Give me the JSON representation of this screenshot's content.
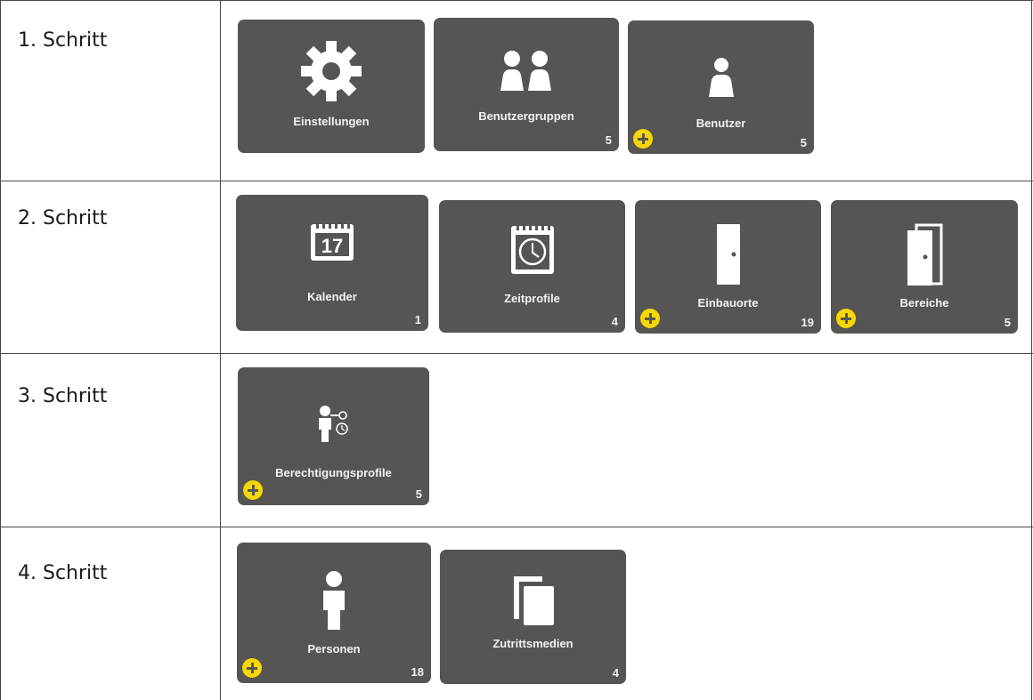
{
  "steps": [
    {
      "label": "1. Schritt"
    },
    {
      "label": "2. Schritt"
    },
    {
      "label": "3. Schritt"
    },
    {
      "label": "4. Schritt"
    }
  ],
  "tiles": {
    "einstellungen": {
      "label": "Einstellungen",
      "icon": "gear-icon"
    },
    "benutzergruppen": {
      "label": "Benutzergruppen",
      "count": "5",
      "icon": "user-group-icon"
    },
    "benutzer": {
      "label": "Benutzer",
      "count": "5",
      "icon": "user-icon",
      "add": "add-icon"
    },
    "kalender": {
      "label": "Kalender",
      "count": "1",
      "icon": "calendar-icon",
      "calendar_day": "17"
    },
    "zeitprofile": {
      "label": "Zeitprofile",
      "count": "4",
      "icon": "calendar-clock-icon"
    },
    "einbauorte": {
      "label": "Einbauorte",
      "count": "19",
      "icon": "door-icon",
      "add": "add-icon"
    },
    "bereiche": {
      "label": "Bereiche",
      "count": "5",
      "icon": "doors-icon",
      "add": "add-icon"
    },
    "berechtigungsprofile": {
      "label": "Berechtigungsprofile",
      "count": "5",
      "icon": "person-key-clock-icon",
      "add": "add-icon"
    },
    "personen": {
      "label": "Personen",
      "count": "18",
      "icon": "person-icon",
      "add": "add-icon"
    },
    "zutrittsmedien": {
      "label": "Zutrittsmedien",
      "count": "4",
      "icon": "cards-icon"
    }
  },
  "colors": {
    "tile": "#575553",
    "icon": "#ffffff",
    "add_badge": "#f5d800",
    "grid": "#4a4a4a"
  }
}
